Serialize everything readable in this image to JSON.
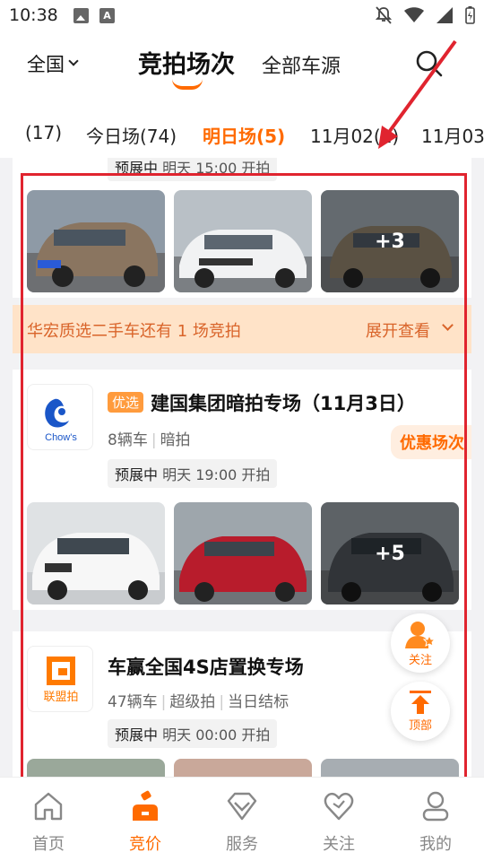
{
  "status_bar": {
    "time": "10:38"
  },
  "header": {
    "region": "全国",
    "active_tab": "竞拍场次",
    "other_tab": "全部车源"
  },
  "date_tabs": [
    {
      "label": "(17)",
      "active": false
    },
    {
      "label": "今日场(74)",
      "active": false
    },
    {
      "label": "明日场(5)",
      "active": true
    },
    {
      "label": "11月02(1)",
      "active": false
    },
    {
      "label": "11月03",
      "active": false
    }
  ],
  "auction_cards": [
    {
      "status": "预展中",
      "status_time": "明天 15:00 开拍",
      "photos": [
        {
          "more": ""
        },
        {
          "more": ""
        },
        {
          "more": "+3"
        }
      ]
    },
    {
      "tag": "优选",
      "logo_text": "Chow's",
      "title": "建国集团暗拍专场（11月3日）",
      "car_count": "8辆车",
      "auction_type": "暗拍",
      "promo": "优惠场次",
      "status": "预展中",
      "status_time": "明天 19:00 开拍",
      "photos": [
        {
          "more": ""
        },
        {
          "more": ""
        },
        {
          "more": "+5"
        }
      ]
    },
    {
      "logo_text": "联盟拍",
      "title": "车赢全国4S店置换专场",
      "car_count": "47辆车",
      "auction_type": "超级拍",
      "settle": "当日结标",
      "status": "预展中",
      "status_time": "明天 00:00 开拍"
    }
  ],
  "banner": {
    "text": "华宏质选二手车还有 1 场竞拍",
    "action": "展开查看"
  },
  "floating": {
    "follow": "关注",
    "top": "顶部"
  },
  "bottom_nav": [
    {
      "label": "首页",
      "icon": "home-icon"
    },
    {
      "label": "竞价",
      "icon": "auction-icon"
    },
    {
      "label": "服务",
      "icon": "diamond-icon"
    },
    {
      "label": "关注",
      "icon": "heart-icon"
    },
    {
      "label": "我的",
      "icon": "user-icon"
    }
  ],
  "colors": {
    "accent": "#ff6a00",
    "highlight": "#e0242f",
    "banner_bg": "#ffe3c8"
  }
}
